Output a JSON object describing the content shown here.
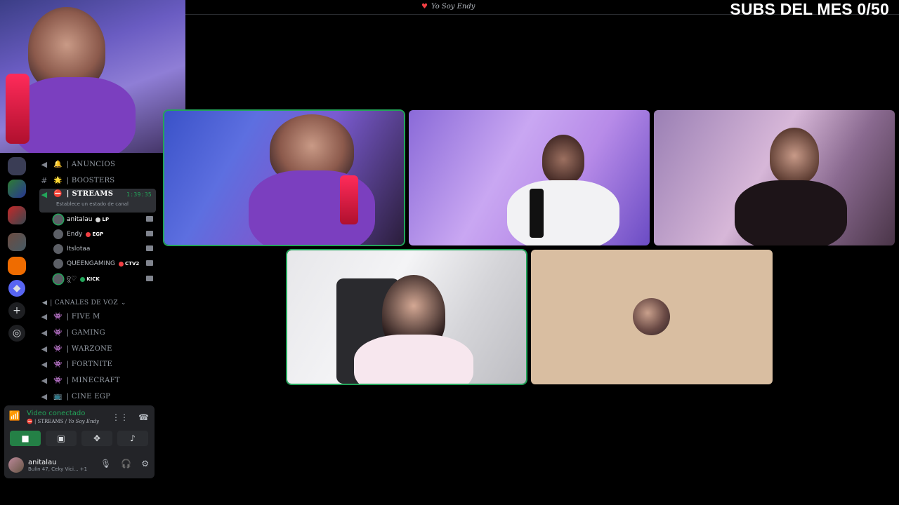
{
  "header": {
    "server_title": "Yo Soy Endy",
    "subs_counter": "SUBS DEL MES 0/50"
  },
  "sidebar": {
    "channels": [
      {
        "icon": "megaphone-icon",
        "emoji": "🔔",
        "name": "| ANUNCIOS"
      },
      {
        "icon": "hash-icon",
        "emoji": "🌟",
        "name": "| BOOSTERS"
      }
    ],
    "active_channel": {
      "emoji": "⛔",
      "name": "| STREAMS",
      "timer": "1:39:35",
      "status": "Establece un estado de canal"
    },
    "members": [
      {
        "name": "anitalau",
        "badge": "LP",
        "badge_color": "#d9d9d9",
        "highlight": true
      },
      {
        "name": "Endy",
        "badge": "EGP",
        "badge_color": "#f23f43",
        "highlight": false
      },
      {
        "name": "Itslotaa",
        "badge": "",
        "badge_color": "",
        "highlight": false
      },
      {
        "name": "QUEENGAMING",
        "badge": "CTV2",
        "badge_color": "#f23f43",
        "highlight": false
      },
      {
        "name": "ବୁ♡",
        "badge": "KICK",
        "badge_color": "#23a55a",
        "highlight": false
      }
    ],
    "category": "| CANALES DE VOZ",
    "voice_channels": [
      {
        "emoji": "👾",
        "name": "| FIVE M"
      },
      {
        "emoji": "👾",
        "name": "|  GAMING"
      },
      {
        "emoji": "👾",
        "name": "| WARZONE"
      },
      {
        "emoji": "👾",
        "name": "| FORTNITE"
      },
      {
        "emoji": "👾",
        "name": "| MINECRAFT"
      },
      {
        "emoji": "📺",
        "name": "| CINE EGP"
      }
    ]
  },
  "voice_panel": {
    "status": "Video conectado",
    "location_channel": "| STREAMS",
    "location_server": "Yo Soy Endy",
    "username": "anitalau",
    "activity": "Bulin 47, Ceky Vici... +1"
  },
  "colors": {
    "accent_green": "#23a55a",
    "danger_red": "#f23f43",
    "panel_bg": "#232428",
    "profile_tile_bg": "#d9bea1"
  }
}
